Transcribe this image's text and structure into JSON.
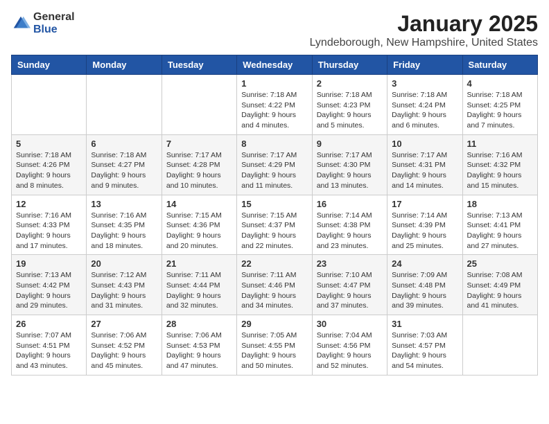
{
  "header": {
    "logo_general": "General",
    "logo_blue": "Blue",
    "month_title": "January 2025",
    "location": "Lyndeborough, New Hampshire, United States"
  },
  "weekdays": [
    "Sunday",
    "Monday",
    "Tuesday",
    "Wednesday",
    "Thursday",
    "Friday",
    "Saturday"
  ],
  "weeks": [
    [
      {
        "day": "",
        "info": ""
      },
      {
        "day": "",
        "info": ""
      },
      {
        "day": "",
        "info": ""
      },
      {
        "day": "1",
        "info": "Sunrise: 7:18 AM\nSunset: 4:22 PM\nDaylight: 9 hours and 4 minutes."
      },
      {
        "day": "2",
        "info": "Sunrise: 7:18 AM\nSunset: 4:23 PM\nDaylight: 9 hours and 5 minutes."
      },
      {
        "day": "3",
        "info": "Sunrise: 7:18 AM\nSunset: 4:24 PM\nDaylight: 9 hours and 6 minutes."
      },
      {
        "day": "4",
        "info": "Sunrise: 7:18 AM\nSunset: 4:25 PM\nDaylight: 9 hours and 7 minutes."
      }
    ],
    [
      {
        "day": "5",
        "info": "Sunrise: 7:18 AM\nSunset: 4:26 PM\nDaylight: 9 hours and 8 minutes."
      },
      {
        "day": "6",
        "info": "Sunrise: 7:18 AM\nSunset: 4:27 PM\nDaylight: 9 hours and 9 minutes."
      },
      {
        "day": "7",
        "info": "Sunrise: 7:17 AM\nSunset: 4:28 PM\nDaylight: 9 hours and 10 minutes."
      },
      {
        "day": "8",
        "info": "Sunrise: 7:17 AM\nSunset: 4:29 PM\nDaylight: 9 hours and 11 minutes."
      },
      {
        "day": "9",
        "info": "Sunrise: 7:17 AM\nSunset: 4:30 PM\nDaylight: 9 hours and 13 minutes."
      },
      {
        "day": "10",
        "info": "Sunrise: 7:17 AM\nSunset: 4:31 PM\nDaylight: 9 hours and 14 minutes."
      },
      {
        "day": "11",
        "info": "Sunrise: 7:16 AM\nSunset: 4:32 PM\nDaylight: 9 hours and 15 minutes."
      }
    ],
    [
      {
        "day": "12",
        "info": "Sunrise: 7:16 AM\nSunset: 4:33 PM\nDaylight: 9 hours and 17 minutes."
      },
      {
        "day": "13",
        "info": "Sunrise: 7:16 AM\nSunset: 4:35 PM\nDaylight: 9 hours and 18 minutes."
      },
      {
        "day": "14",
        "info": "Sunrise: 7:15 AM\nSunset: 4:36 PM\nDaylight: 9 hours and 20 minutes."
      },
      {
        "day": "15",
        "info": "Sunrise: 7:15 AM\nSunset: 4:37 PM\nDaylight: 9 hours and 22 minutes."
      },
      {
        "day": "16",
        "info": "Sunrise: 7:14 AM\nSunset: 4:38 PM\nDaylight: 9 hours and 23 minutes."
      },
      {
        "day": "17",
        "info": "Sunrise: 7:14 AM\nSunset: 4:39 PM\nDaylight: 9 hours and 25 minutes."
      },
      {
        "day": "18",
        "info": "Sunrise: 7:13 AM\nSunset: 4:41 PM\nDaylight: 9 hours and 27 minutes."
      }
    ],
    [
      {
        "day": "19",
        "info": "Sunrise: 7:13 AM\nSunset: 4:42 PM\nDaylight: 9 hours and 29 minutes."
      },
      {
        "day": "20",
        "info": "Sunrise: 7:12 AM\nSunset: 4:43 PM\nDaylight: 9 hours and 31 minutes."
      },
      {
        "day": "21",
        "info": "Sunrise: 7:11 AM\nSunset: 4:44 PM\nDaylight: 9 hours and 32 minutes."
      },
      {
        "day": "22",
        "info": "Sunrise: 7:11 AM\nSunset: 4:46 PM\nDaylight: 9 hours and 34 minutes."
      },
      {
        "day": "23",
        "info": "Sunrise: 7:10 AM\nSunset: 4:47 PM\nDaylight: 9 hours and 37 minutes."
      },
      {
        "day": "24",
        "info": "Sunrise: 7:09 AM\nSunset: 4:48 PM\nDaylight: 9 hours and 39 minutes."
      },
      {
        "day": "25",
        "info": "Sunrise: 7:08 AM\nSunset: 4:49 PM\nDaylight: 9 hours and 41 minutes."
      }
    ],
    [
      {
        "day": "26",
        "info": "Sunrise: 7:07 AM\nSunset: 4:51 PM\nDaylight: 9 hours and 43 minutes."
      },
      {
        "day": "27",
        "info": "Sunrise: 7:06 AM\nSunset: 4:52 PM\nDaylight: 9 hours and 45 minutes."
      },
      {
        "day": "28",
        "info": "Sunrise: 7:06 AM\nSunset: 4:53 PM\nDaylight: 9 hours and 47 minutes."
      },
      {
        "day": "29",
        "info": "Sunrise: 7:05 AM\nSunset: 4:55 PM\nDaylight: 9 hours and 50 minutes."
      },
      {
        "day": "30",
        "info": "Sunrise: 7:04 AM\nSunset: 4:56 PM\nDaylight: 9 hours and 52 minutes."
      },
      {
        "day": "31",
        "info": "Sunrise: 7:03 AM\nSunset: 4:57 PM\nDaylight: 9 hours and 54 minutes."
      },
      {
        "day": "",
        "info": ""
      }
    ]
  ]
}
